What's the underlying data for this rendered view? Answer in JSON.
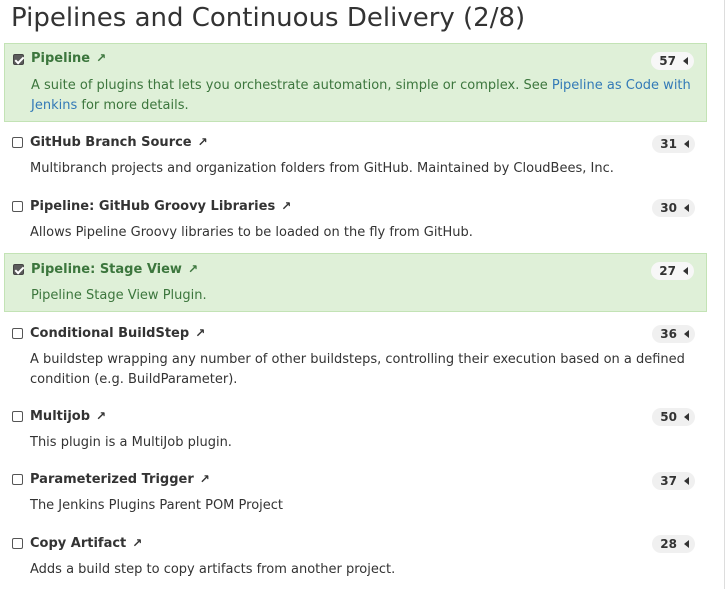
{
  "title": "Pipelines and Continuous Delivery (2/8)",
  "plugins": [
    {
      "name": "Pipeline",
      "count": "57",
      "checked": true,
      "desc_before": "A suite of plugins that lets you orchestrate automation, simple or complex. See ",
      "desc_link": "Pipeline as Code with Jenkins",
      "desc_after": " for more details."
    },
    {
      "name": "GitHub Branch Source",
      "count": "31",
      "checked": false,
      "desc": "Multibranch projects and organization folders from GitHub. Maintained by CloudBees, Inc."
    },
    {
      "name": "Pipeline: GitHub Groovy Libraries",
      "count": "30",
      "checked": false,
      "desc": "Allows Pipeline Groovy libraries to be loaded on the fly from GitHub."
    },
    {
      "name": "Pipeline: Stage View",
      "count": "27",
      "checked": true,
      "desc": "Pipeline Stage View Plugin."
    },
    {
      "name": "Conditional BuildStep",
      "count": "36",
      "checked": false,
      "desc": "A buildstep wrapping any number of other buildsteps, controlling their execution based on a defined condition (e.g. BuildParameter)."
    },
    {
      "name": "Multijob",
      "count": "50",
      "checked": false,
      "desc": "This plugin is a MultiJob plugin."
    },
    {
      "name": "Parameterized Trigger",
      "count": "37",
      "checked": false,
      "desc": "The Jenkins Plugins Parent POM Project"
    },
    {
      "name": "Copy Artifact",
      "count": "28",
      "checked": false,
      "desc": "Adds a build step to copy artifacts from another project."
    }
  ],
  "icons": {
    "external_link": "external-link-icon",
    "caret": "caret-left-icon",
    "checkbox": "checkbox"
  }
}
